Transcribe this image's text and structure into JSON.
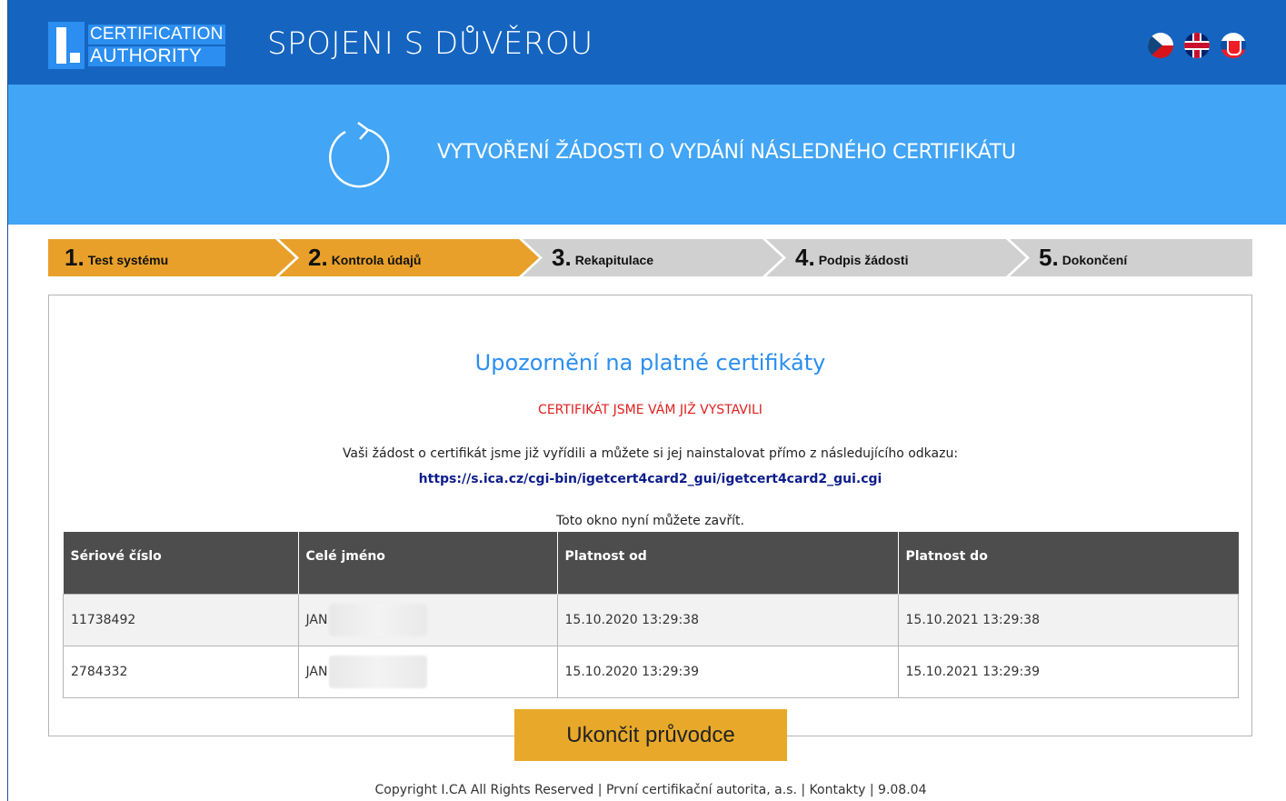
{
  "header": {
    "logo_line1": "CERTIFICATION",
    "logo_line2": "AUTHORITY",
    "slogan": "SPOJENI S DŮVĚROU",
    "languages": [
      "cz-flag-icon",
      "en-flag-icon",
      "sk-flag-icon"
    ]
  },
  "banner": {
    "icon": "refresh-icon",
    "title": "VYTVOŘENÍ ŽÁDOSTI O VYDÁNÍ NÁSLEDNÉHO CERTIFIKÁTU"
  },
  "steps": [
    {
      "num": "1.",
      "label": "Test systému",
      "state": "done"
    },
    {
      "num": "2.",
      "label": "Kontrola údajů",
      "state": "active"
    },
    {
      "num": "3.",
      "label": "Rekapitulace",
      "state": "pending"
    },
    {
      "num": "4.",
      "label": "Podpis žádosti",
      "state": "pending"
    },
    {
      "num": "5.",
      "label": "Dokončení",
      "state": "pending"
    }
  ],
  "content": {
    "title": "Upozornění na platné certifikáty",
    "warning": "CERTIFIKÁT JSME VÁM JIŽ VYSTAVILI",
    "info": "Vaši žádost o certifikát jsme již vyřídili a můžete si jej nainstalovat přímo z následujícího odkazu:",
    "link": "https://s.ica.cz/cgi-bin/igetcert4card2_gui/igetcert4card2_gui.cgi",
    "close_note": "Toto okno nyní můžete zavřít."
  },
  "table": {
    "columns": [
      "Sériové číslo",
      "Celé jméno",
      "Platnost od",
      "Platnost do"
    ],
    "rows": [
      [
        "11738492",
        "JAN",
        "15.10.2020 13:29:38",
        "15.10.2021 13:29:38"
      ],
      [
        "2784332",
        "JAN",
        "15.10.2020 13:29:39",
        "15.10.2021 13:29:39"
      ]
    ]
  },
  "finish_button": "Ukončit průvodce",
  "footer": {
    "copyright": "Copyright I.CA All Rights Reserved",
    "company": "První certifikační autorita, a.s.",
    "contacts": "Kontakty",
    "version": "9.08.04",
    "separator": "|"
  },
  "colors": {
    "header": "#1565c0",
    "banner": "#42a5f5",
    "accent": "#e8a92a",
    "title": "#2b8ef0",
    "warning": "#e02020"
  }
}
